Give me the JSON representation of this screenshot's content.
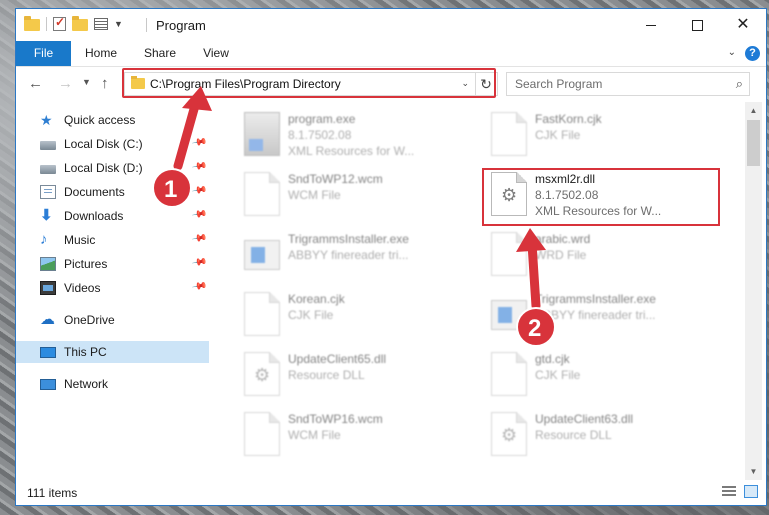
{
  "window": {
    "title": "Program",
    "border_color": "#2b78c5"
  },
  "ribbon": {
    "tabs": [
      "File",
      "Home",
      "Share",
      "View"
    ],
    "file_color": "#1979ca"
  },
  "address_bar": {
    "path": "C:\\Program Files\\Program Directory",
    "refresh_icon": "refresh-icon"
  },
  "search": {
    "placeholder": "Search Program"
  },
  "nav_pane": {
    "items": [
      {
        "label": "Quick access",
        "icon": "star-icon"
      },
      {
        "label": "Local Disk (C:)",
        "icon": "disk-icon",
        "pinned": true
      },
      {
        "label": "Local Disk (D:)",
        "icon": "disk-icon",
        "pinned": true
      },
      {
        "label": "Documents",
        "icon": "documents-icon",
        "pinned": true
      },
      {
        "label": "Downloads",
        "icon": "download-arrow-icon",
        "pinned": true
      },
      {
        "label": "Music",
        "icon": "music-note-icon",
        "pinned": true
      },
      {
        "label": "Pictures",
        "icon": "pictures-icon",
        "pinned": true
      },
      {
        "label": "Videos",
        "icon": "videos-icon",
        "pinned": true
      },
      {
        "label": "OneDrive",
        "icon": "cloud-icon"
      },
      {
        "label": "This PC",
        "icon": "computer-icon",
        "selected": true
      },
      {
        "label": "Network",
        "icon": "network-icon"
      }
    ]
  },
  "files": [
    {
      "name": "program.exe",
      "line2": "8.1.7502.08",
      "line3": "XML Resources for W...",
      "icon": "exe-icon"
    },
    {
      "name": "FastKorn.cjk",
      "line2": "CJK File",
      "line3": "",
      "icon": "document-icon"
    },
    {
      "name": "SndToWP12.wcm",
      "line2": "WCM File",
      "line3": "",
      "icon": "document-icon"
    },
    {
      "name": "msxml2r.dll",
      "line2": "8.1.7502.08",
      "line3": "XML Resources for W...",
      "icon": "gear-document-icon",
      "highlighted": true
    },
    {
      "name": "TrigrammsInstaller.exe",
      "line2": "ABBYY finereader tri...",
      "line3": "",
      "icon": "installer-icon"
    },
    {
      "name": "arabic.wrd",
      "line2": "WRD File",
      "line3": "",
      "icon": "document-icon"
    },
    {
      "name": "Korean.cjk",
      "line2": "CJK File",
      "line3": "",
      "icon": "document-icon"
    },
    {
      "name": "TrigrammsInstaller.exe",
      "line2": "ABBYY finereader tri...",
      "line3": "",
      "icon": "installer-icon"
    },
    {
      "name": "UpdateClient65.dll",
      "line2": "Resource DLL",
      "line3": "",
      "icon": "gear-document-icon"
    },
    {
      "name": "gtd.cjk",
      "line2": "CJK File",
      "line3": "",
      "icon": "document-icon"
    },
    {
      "name": "SndToWP16.wcm",
      "line2": "WCM File",
      "line3": "",
      "icon": "document-icon"
    },
    {
      "name": "UpdateClient63.dll",
      "line2": "Resource DLL",
      "line3": "",
      "icon": "gear-document-icon"
    }
  ],
  "status": {
    "item_count": "111 items"
  },
  "annotations": {
    "steps": [
      "1",
      "2"
    ],
    "color": "#d8333b"
  }
}
